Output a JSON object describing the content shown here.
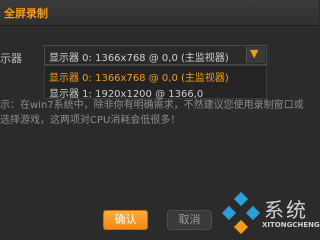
{
  "window": {
    "title": "全屏录制"
  },
  "display": {
    "label": "示器",
    "selected": "显示器 0: 1366x768 @ 0,0 (主监视器)",
    "options": [
      "显示器 0: 1366x768 @ 0,0 (主监视器)",
      "显示器 1: 1920x1200 @ 1366,0"
    ],
    "dropdown_icon": "triangle-down-icon"
  },
  "tips": {
    "line1": "示：在win7系统中，除非你有明确需求，不然建议您使用录制窗口或",
    "line2": "选择游戏，这两项对CPU消耗会低很多！"
  },
  "buttons": {
    "ok": "确认",
    "cancel": "取消"
  },
  "watermark": {
    "text": "系统",
    "domain": "XITONGCHENG"
  },
  "colors": {
    "accent": "#f39a1f",
    "background": "#2b2b2b"
  }
}
